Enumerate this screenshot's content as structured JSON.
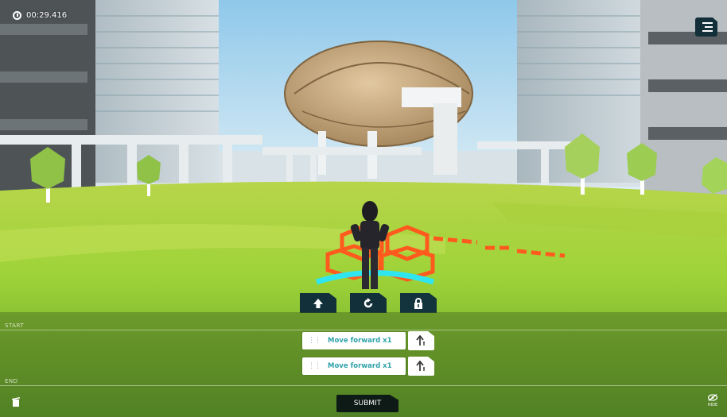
{
  "hud": {
    "timer": "00:29.416",
    "menu_icon": "hamburger-menu-icon"
  },
  "toolbar": {
    "tools": [
      {
        "name": "move-forward-tool",
        "icon": "up-arrow-icon"
      },
      {
        "name": "turn-tool",
        "icon": "rotate-icon"
      },
      {
        "name": "lock-tool",
        "icon": "lock-icon"
      }
    ]
  },
  "program": {
    "start_label": "START",
    "end_label": "END",
    "steps": [
      {
        "label": "Move forward x1",
        "icon": "forward-step-icon"
      },
      {
        "label": "Move forward x1",
        "icon": "forward-step-icon"
      }
    ]
  },
  "footer": {
    "submit_label": "SUBMIT",
    "hide_label": "HIDE",
    "trash_icon": "trash-icon"
  },
  "colors": {
    "panel": "#3e601c",
    "button_dark": "#12303a",
    "step_text": "#2ea2a8",
    "highlight_orange": "#ff5a1e",
    "highlight_cyan": "#2fe6f0"
  }
}
